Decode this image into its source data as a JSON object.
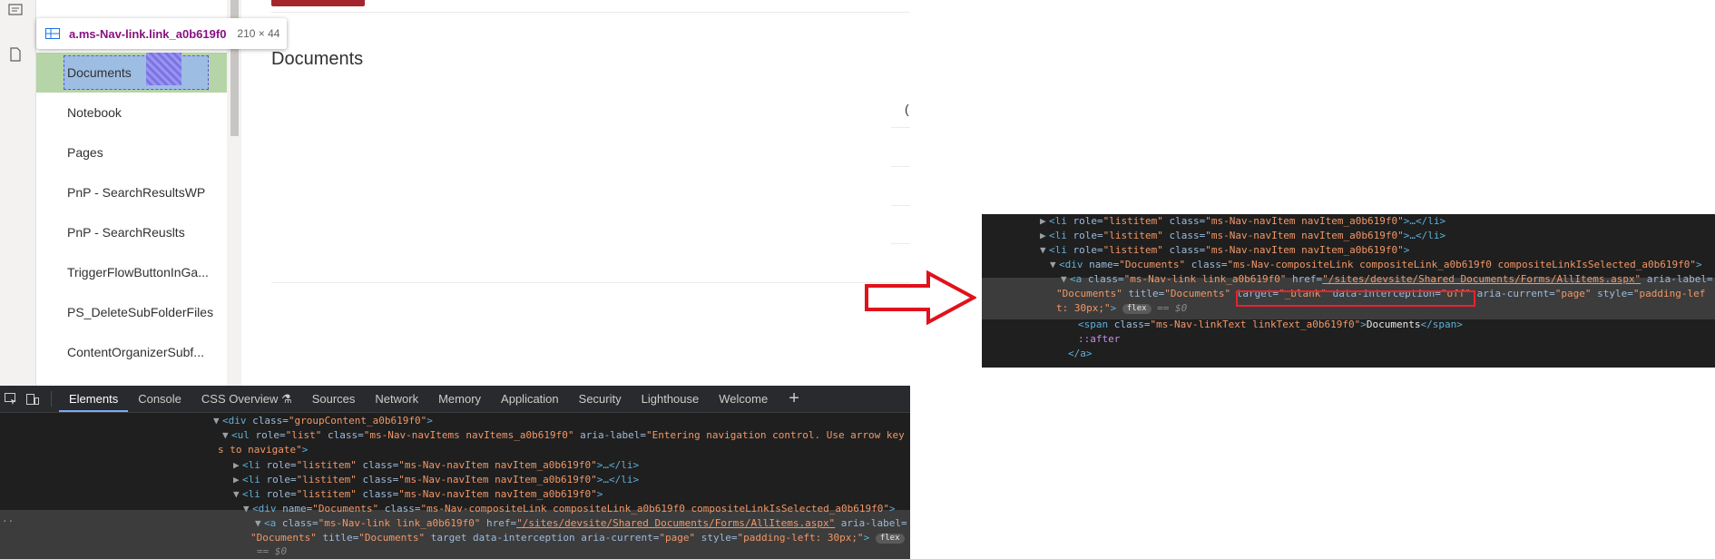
{
  "tooltip": {
    "selector": "a.ms-Nav-link.link_a0b619f0",
    "dimensions": "210 × 44"
  },
  "nav": {
    "items": [
      {
        "label": "Documents",
        "selected": true
      },
      {
        "label": "Notebook"
      },
      {
        "label": "Pages"
      },
      {
        "label": "PnP - SearchResultsWP"
      },
      {
        "label": "PnP - SearchReuslts"
      },
      {
        "label": "TriggerFlowButtonInGa..."
      },
      {
        "label": "PS_DeleteSubFolderFiles"
      },
      {
        "label": "ContentOrganizerSubf..."
      }
    ]
  },
  "content": {
    "title": "Documents",
    "partial_glyph": "("
  },
  "devtools": {
    "tabs": [
      {
        "label": "Elements",
        "active": true
      },
      {
        "label": "Console"
      },
      {
        "label": "CSS Overview ⚗"
      },
      {
        "label": "Sources"
      },
      {
        "label": "Network"
      },
      {
        "label": "Memory"
      },
      {
        "label": "Application"
      },
      {
        "label": "Security"
      },
      {
        "label": "Lighthouse"
      },
      {
        "label": "Welcome"
      }
    ],
    "add_tab": "+",
    "left_dots": "..",
    "code": {
      "l0_tag_open": "<div ",
      "l0_attr": "class=",
      "l0_val": "\"groupContent_a0b619f0\"",
      "l0_close": ">",
      "l1_tag": "<ul ",
      "l1_a1": "role=",
      "l1_v1": "\"list\"",
      "l1_a2": " class=",
      "l1_v2": "\"ms-Nav-navItems navItems_a0b619f0\"",
      "l1_a3": " aria-label=",
      "l1_v3a": "\"Entering navigation control. Use arrow key",
      "l1_v3b": "s to navigate\"",
      "li_tag": "<li ",
      "li_a1": "role=",
      "li_v1": "\"listitem\"",
      "li_a2": " class=",
      "li_v2": "\"ms-Nav-navItem navItem_a0b619f0\"",
      "li_collapsed_end": ">…</li>",
      "li_open_end": ">",
      "div_tag": "<div ",
      "div_a1": "name=",
      "div_v1": "\"Documents\"",
      "div_a2": " class=",
      "div_v2": "\"ms-Nav-compositeLink compositeLink_a0b619f0 compositeLinkIsSelected_a0b619f0\"",
      "a_tag": "<a ",
      "a_a1": "class=",
      "a_v1": "\"ms-Nav-link link_a0b619f0\"",
      "a_a2": " href=",
      "a_v2": "\"/sites/devsite/Shared Documents/Forms/AllItems.aspx\"",
      "a_a3": " aria-label=",
      "a_v3": "\"Documents\"",
      "a_a4": " title=",
      "a_v4": "\"Documents\"",
      "a_a5": " target",
      "a_a6": " data-interception",
      "a_a7": " aria-current=",
      "a_v7": "\"page\"",
      "a_a8": " style=",
      "a_v8": "\"padding-left: 30px;\"",
      "a_end": ">",
      "flex_badge": "flex",
      "eq0": "== $0"
    }
  },
  "snippet": {
    "a_a5": " target=",
    "a_v5": "\"_blank\"",
    "a_a6": " data-interception=",
    "a_v6": "\"off\"",
    "a_v8a": "\"padding-lef",
    "a_v8b": "t: 30px;\"",
    "span_tag": "<span ",
    "span_attr": "class=",
    "span_val": "\"ms-Nav-linkText linkText_a0b619f0\"",
    "span_text": "Documents",
    "span_close": "</span>",
    "after": "::after",
    "a_close": "</a>"
  }
}
